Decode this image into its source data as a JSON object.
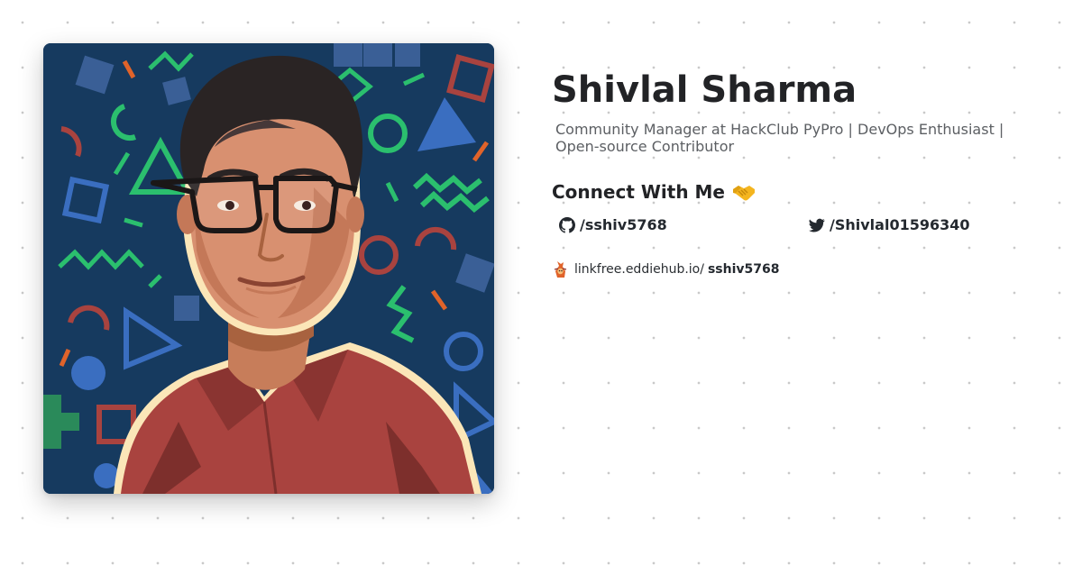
{
  "profile": {
    "name": "Shivlal Sharma",
    "bio": "Community Manager at HackClub PyPro | DevOps Enthusiast | Open-source Contributor",
    "avatar_icon": "cartoon-portrait-avatar"
  },
  "connect": {
    "heading": "Connect With Me",
    "emoji_icon": "handshake-icon"
  },
  "links": {
    "github": {
      "icon": "github-icon",
      "label": "/sshiv5768"
    },
    "twitter": {
      "icon": "twitter-icon",
      "label": "/Shivlal01596340"
    }
  },
  "linkfree": {
    "icon": "linkfree-logo-icon",
    "domain": "linkfree.eddiehub.io/",
    "handle": "sshiv5768"
  },
  "colors": {
    "background": "#ffffff",
    "dots": "#c9c9c9",
    "avatar_bg": "#163a5f",
    "shirt": "#a9433f",
    "accent_green": "#2bbf6e",
    "accent_orange": "#e0632a",
    "text": "#24292f",
    "muted_text": "#5c5f63"
  }
}
